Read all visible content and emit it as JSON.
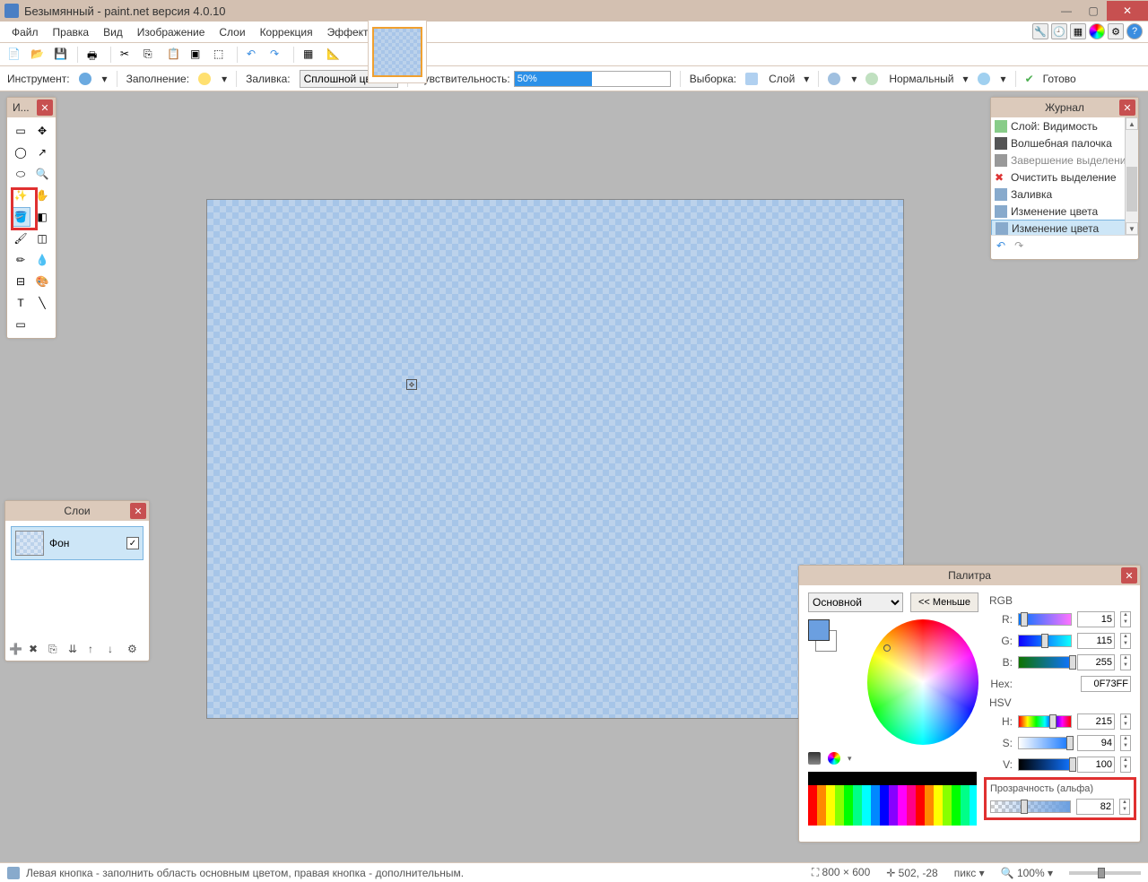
{
  "titlebar": {
    "title": "Безымянный - paint.net версия 4.0.10"
  },
  "menu": {
    "items": [
      "Файл",
      "Правка",
      "Вид",
      "Изображение",
      "Слои",
      "Коррекция",
      "Эффекты"
    ]
  },
  "optbar": {
    "tool_label": "Инструмент:",
    "fill_label": "Заполнение:",
    "flood_label": "Заливка:",
    "flood_mode": "Сплошной цвет",
    "sens_label": "Чувствительность:",
    "sens_value": "50%",
    "sampling_label": "Выборка:",
    "sampling_value": "Слой",
    "blend_label": "Нормальный",
    "done_label": "Готово"
  },
  "tools_panel": {
    "title": "И..."
  },
  "layers_panel": {
    "title": "Слои",
    "layer_name": "Фон"
  },
  "history_panel": {
    "title": "Журнал",
    "items": [
      {
        "icon": "eye",
        "label": "Слой: Видимость"
      },
      {
        "icon": "wand",
        "label": "Волшебная палочка"
      },
      {
        "icon": "wand",
        "label": "Завершение выделения палочко",
        "sub": true
      },
      {
        "icon": "x",
        "label": "Очистить выделение"
      },
      {
        "icon": "bucket",
        "label": "Заливка"
      },
      {
        "icon": "bucket",
        "label": "Изменение цвета"
      },
      {
        "icon": "bucket",
        "label": "Изменение цвета",
        "sel": true
      }
    ]
  },
  "palette_panel": {
    "title": "Палитра",
    "primary": "Основной",
    "less": "<< Меньше",
    "rgb": "RGB",
    "hsv": "HSV",
    "hex_label": "Hex:",
    "hex_value": "0F73FF",
    "r_label": "R:",
    "r_val": "15",
    "g_label": "G:",
    "g_val": "115",
    "b_label": "B:",
    "b_val": "255",
    "h_label": "H:",
    "h_val": "215",
    "s_label": "S:",
    "s_val": "94",
    "v_label": "V:",
    "v_val": "100",
    "alpha_label": "Прозрачность (альфа)",
    "alpha_val": "82"
  },
  "statusbar": {
    "hint": "Левая кнопка - заполнить область основным цветом, правая кнопка - дополнительным.",
    "dims": "800 × 600",
    "pos": "502, -28",
    "unit": "пикс",
    "zoom": "100%"
  }
}
